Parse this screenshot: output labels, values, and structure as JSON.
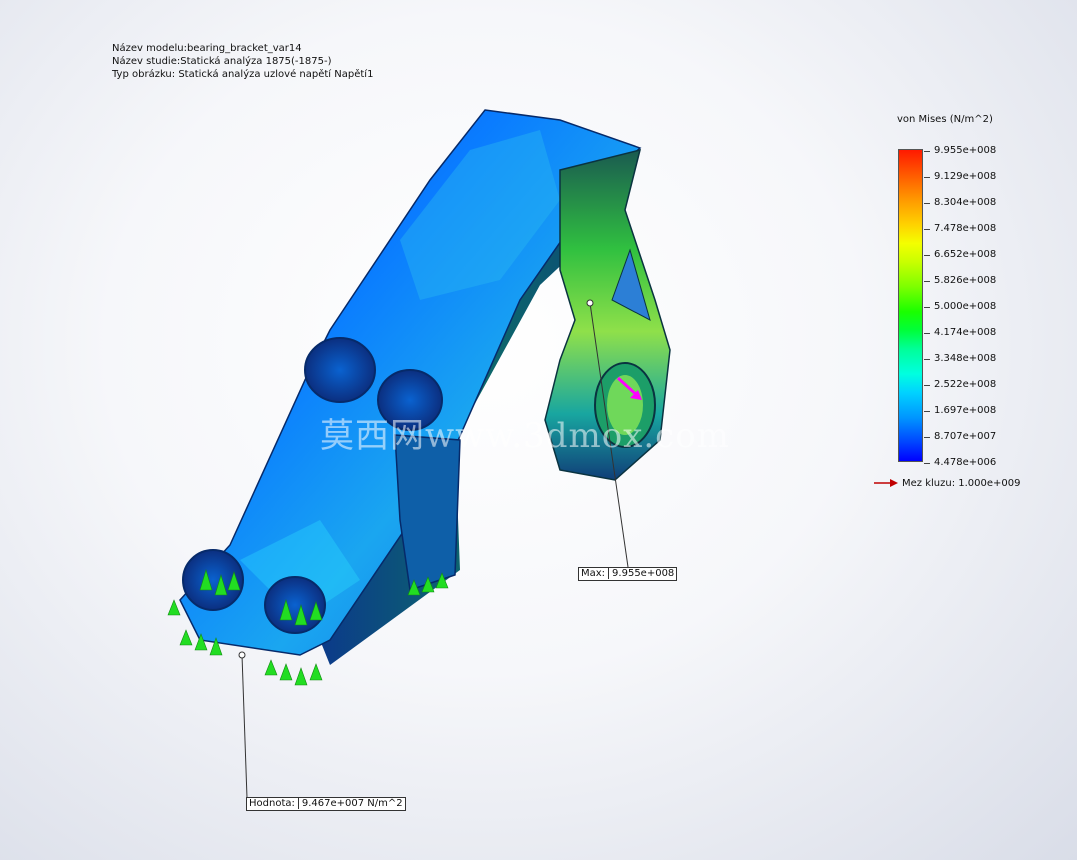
{
  "header": {
    "model_name": "Název modelu:bearing_bracket_var14",
    "study_name": "Název studie:Statická analýza 1875(-1875-)",
    "plot_type": "Typ obrázku: Statická analýza uzlové napětí Napětí1"
  },
  "legend": {
    "title": "von Mises (N/m^2)",
    "ticks": [
      "9.955e+008",
      "9.129e+008",
      "8.304e+008",
      "7.478e+008",
      "6.652e+008",
      "5.826e+008",
      "5.000e+008",
      "4.174e+008",
      "3.348e+008",
      "2.522e+008",
      "1.697e+008",
      "8.707e+007",
      "4.478e+006"
    ],
    "yield_label": "Mez kluzu: 1.000e+009",
    "yield_arrow_color": "#c00000"
  },
  "probes": {
    "max": {
      "key": "Max:",
      "value": "9.955e+008"
    },
    "value": {
      "key": "Hodnota:",
      "value": "9.467e+007 N/m^2"
    }
  },
  "watermark": "莫西网www.3dmox.com",
  "colors": {
    "stress_low": "#0000ff",
    "stress_mid": "#00ff3a",
    "stress_high": "#ff1a00",
    "fixture": "#22dd22",
    "load_arrow": "#ff00ff"
  },
  "icons": [
    "fixture-arrow-icon",
    "load-arrow-icon",
    "yield-arrow-icon"
  ]
}
